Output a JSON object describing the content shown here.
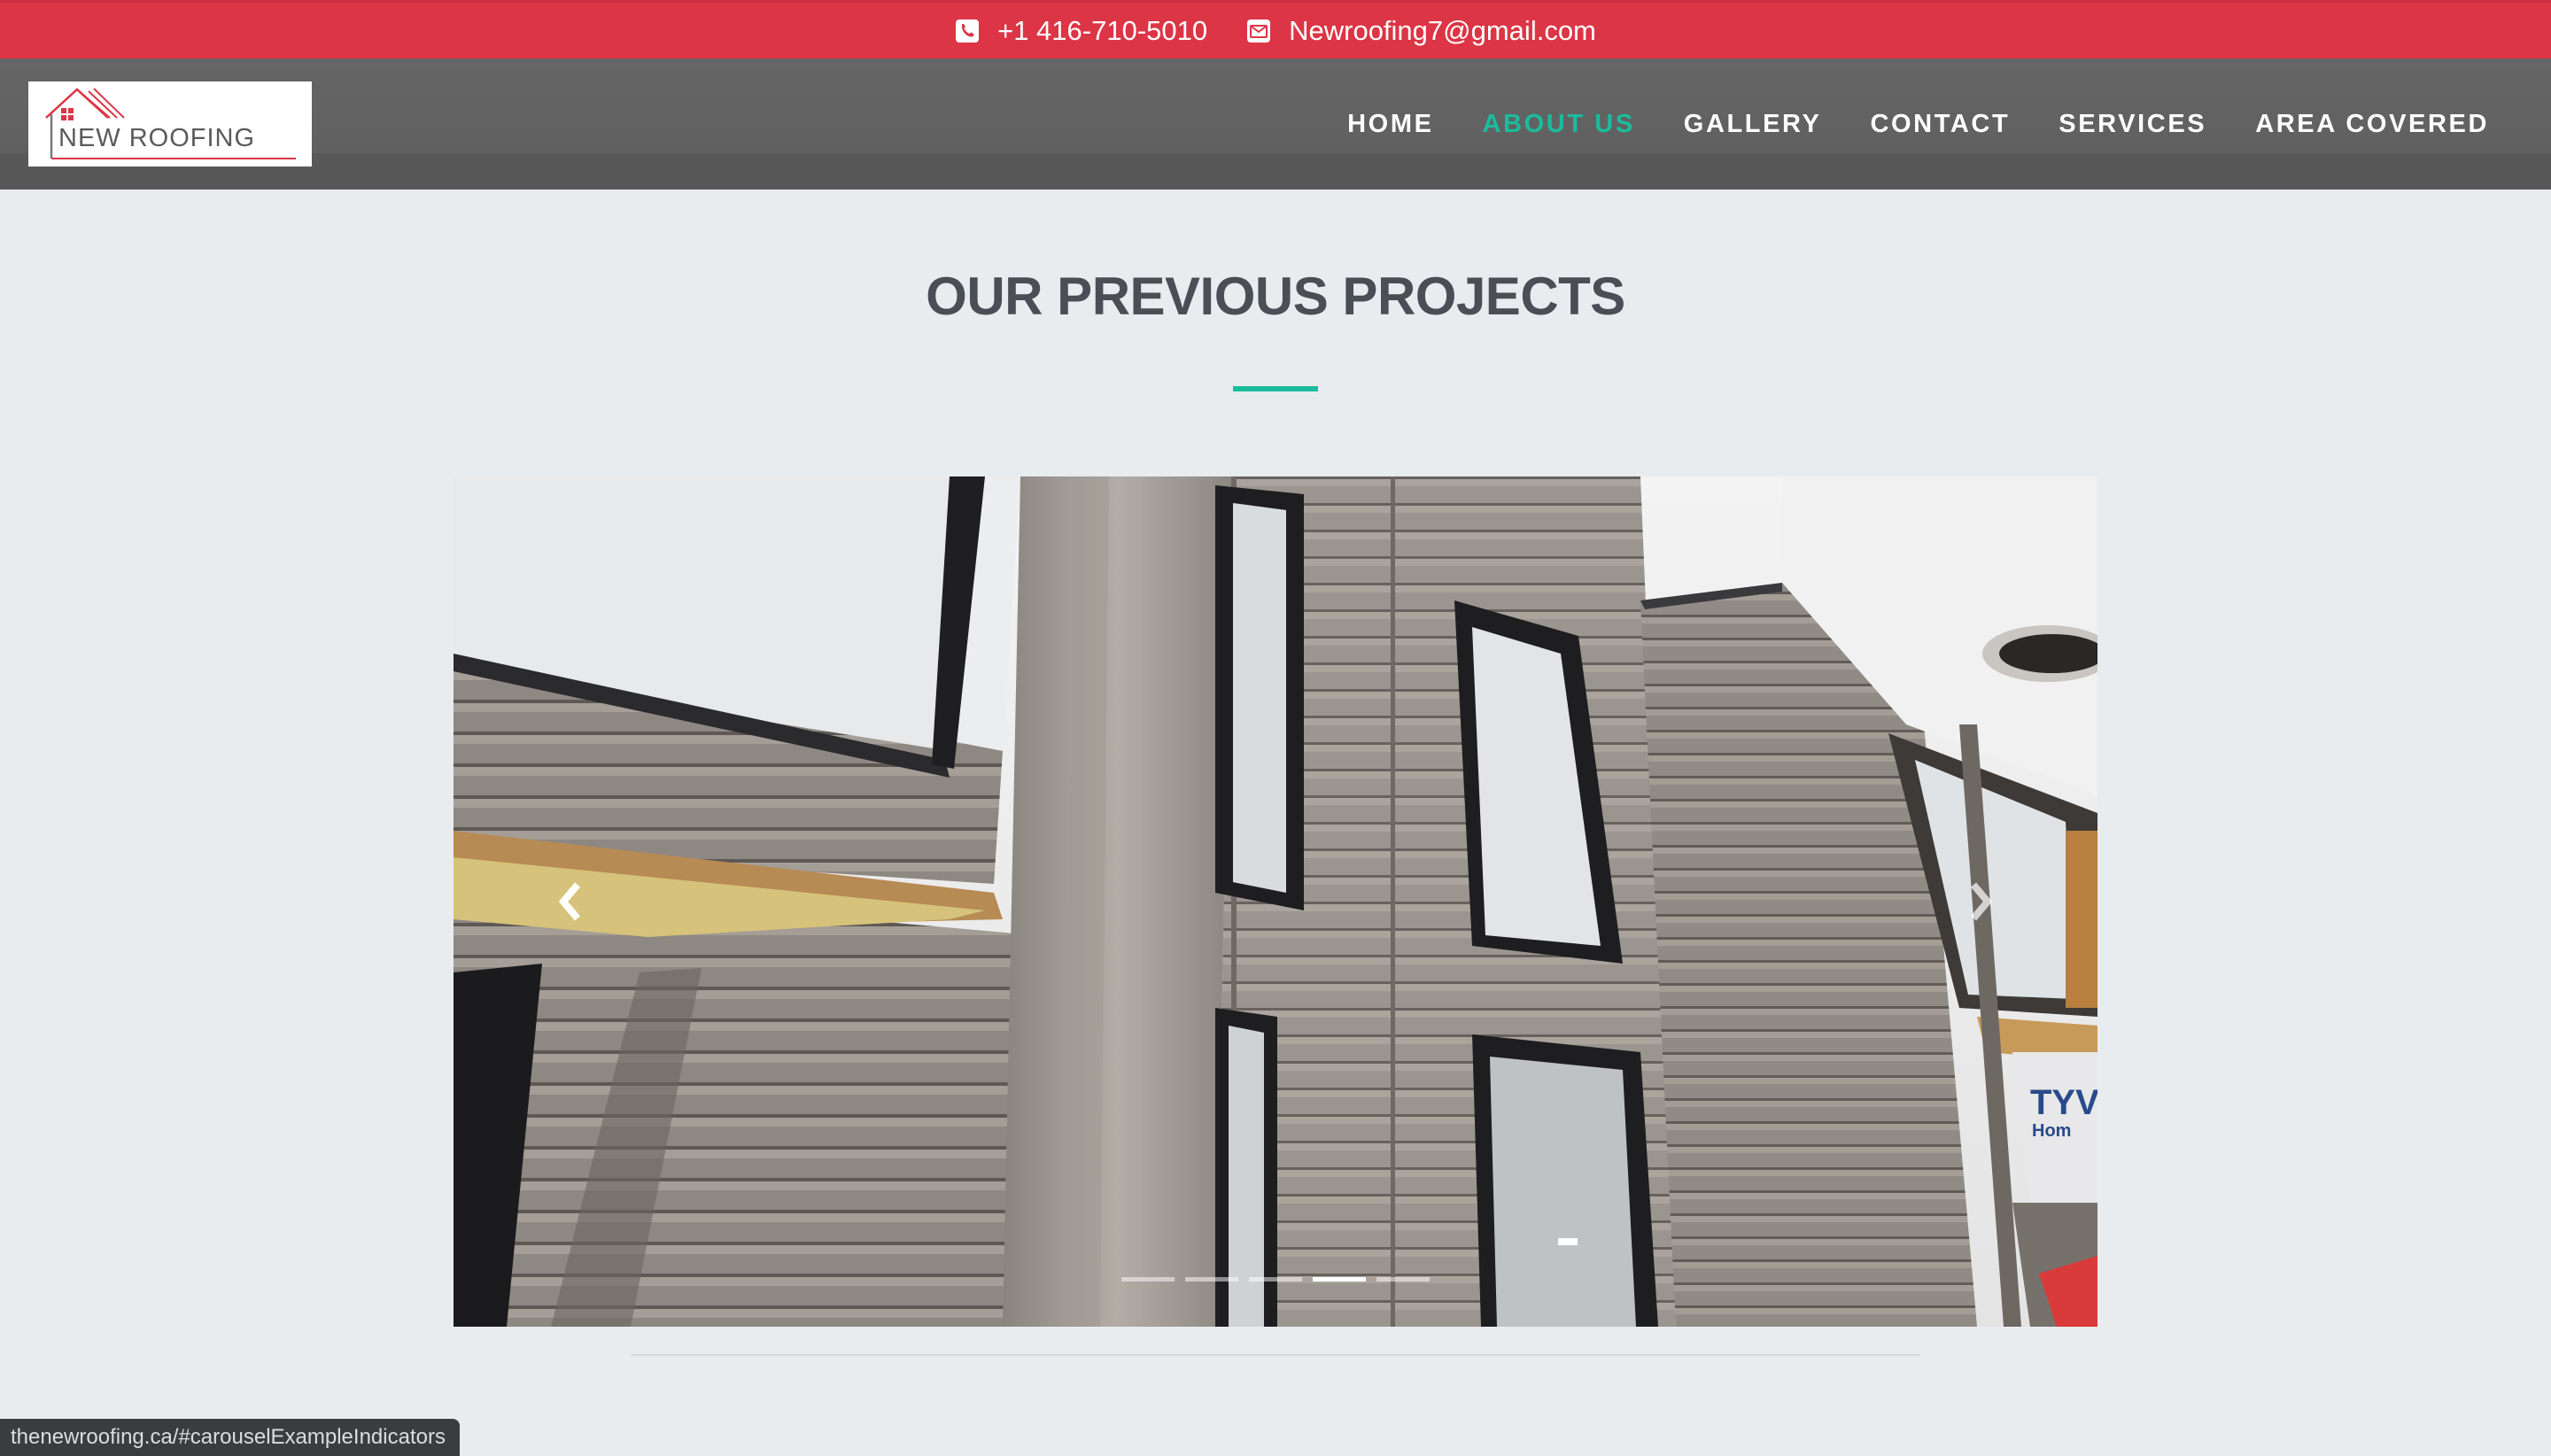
{
  "topbar": {
    "phone_icon": "phone-square-icon",
    "phone": "+1 416-710-5010",
    "email_icon": "envelope-icon",
    "email": "Newroofing7@gmail.com",
    "background_color": "#dc3545"
  },
  "logo": {
    "text": "NEW ROOFING",
    "accent_color": "#dc3545"
  },
  "nav": {
    "items": [
      {
        "label": "HOME",
        "active": false
      },
      {
        "label": "ABOUT US",
        "active": true
      },
      {
        "label": "GALLERY",
        "active": false
      },
      {
        "label": "CONTACT",
        "active": false
      },
      {
        "label": "SERVICES",
        "active": false
      },
      {
        "label": "AREA COVERED",
        "active": false
      }
    ],
    "active_color": "#1abc9c"
  },
  "section": {
    "title": "OUR PREVIOUS PROJECTS",
    "accent_color": "#1abc9c"
  },
  "carousel": {
    "prev_icon": "chevron-left-icon",
    "next_icon": "chevron-right-icon",
    "slide_count": 5,
    "active_index": 3
  },
  "status_bar": {
    "url": "thenewroofing.ca/#carouselExampleIndicators"
  }
}
